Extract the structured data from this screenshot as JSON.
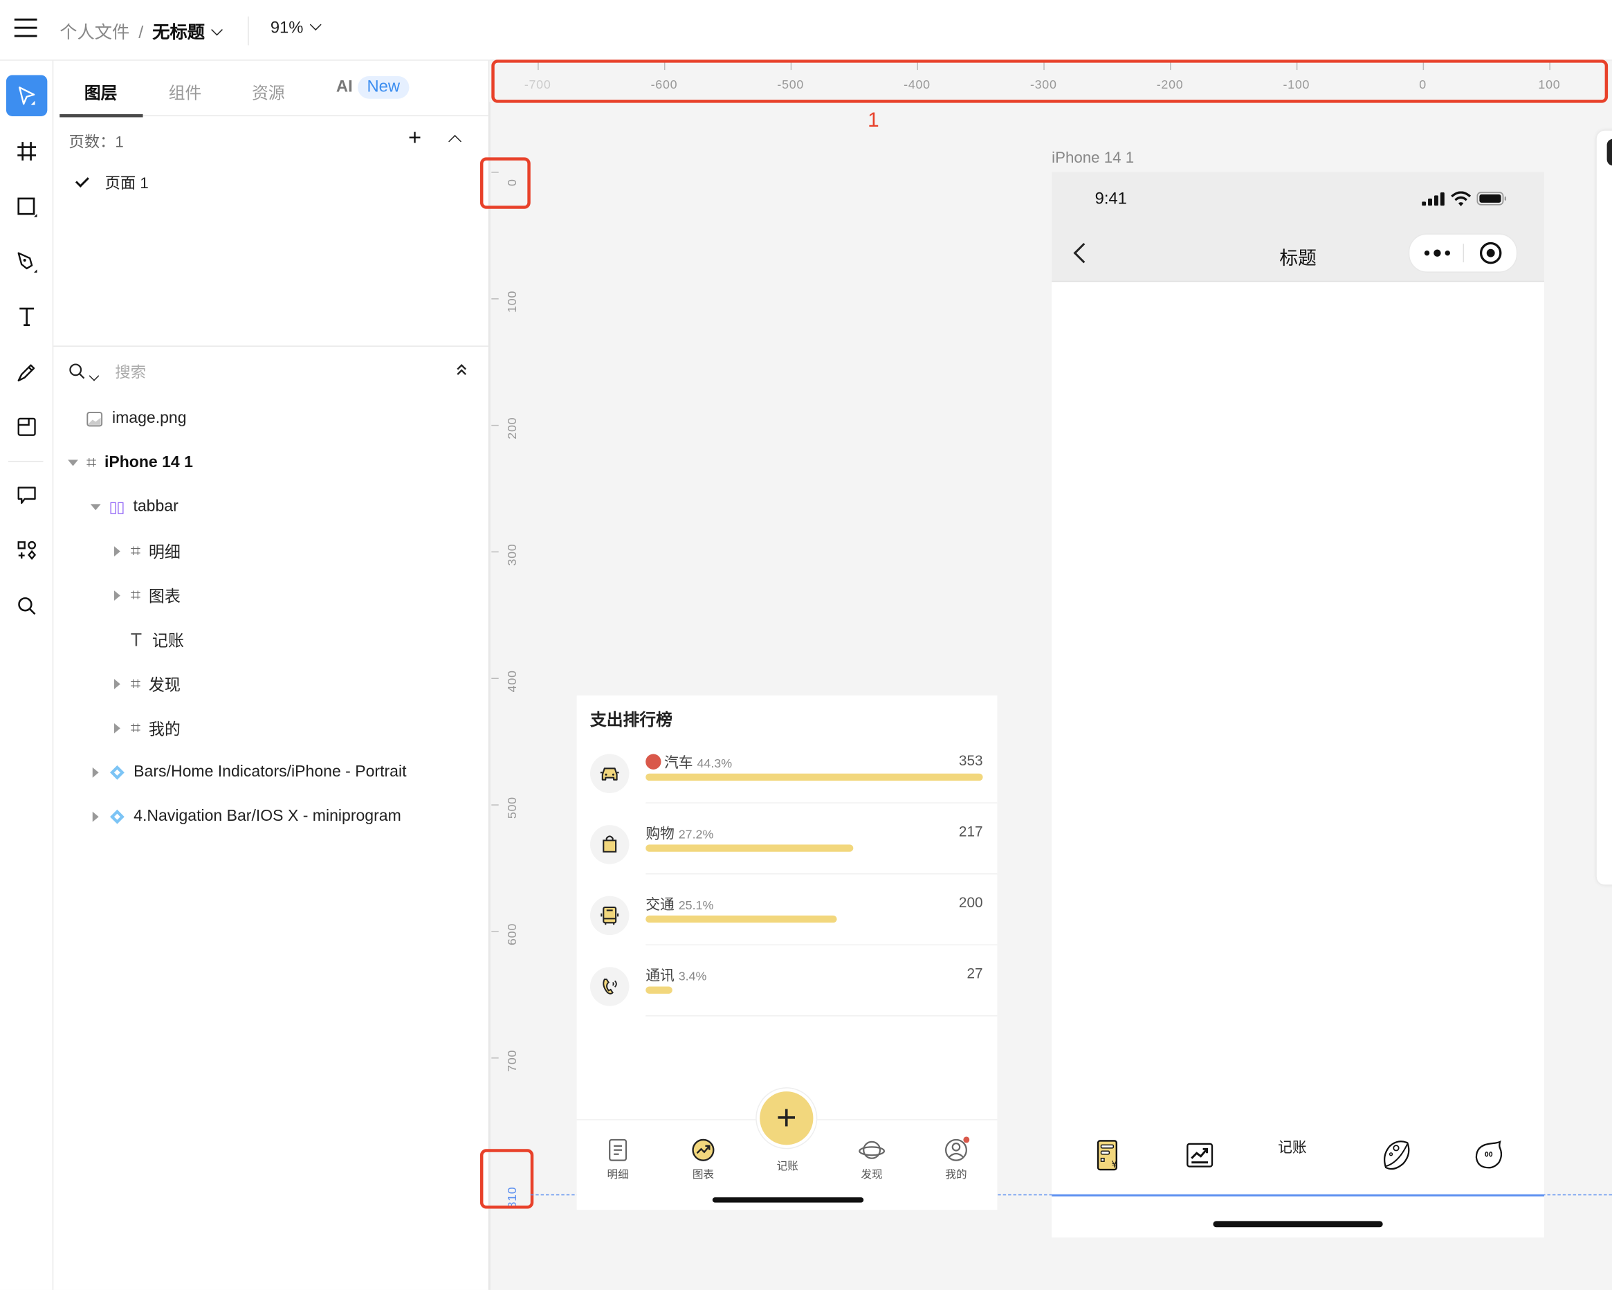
{
  "header": {
    "breadcrumb_parent": "个人文件",
    "breadcrumb_sep": "/",
    "file_title": "无标题",
    "zoom_level": "91%"
  },
  "toolbar": {
    "tools": [
      "move-tool",
      "frame-tool",
      "shape-tool",
      "pen-tool",
      "text-tool",
      "pencil-tool",
      "section-tool",
      "comment-tool",
      "plugins-tool",
      "search-tool"
    ],
    "active_tool": "move-tool",
    "accent_color": "#3d8ef0"
  },
  "panel": {
    "tabs": [
      {
        "label": "图层",
        "active": true
      },
      {
        "label": "组件",
        "active": false
      },
      {
        "label": "资源",
        "active": false
      },
      {
        "label": "AI",
        "active": false
      }
    ],
    "ai_badge": "New",
    "pages_label": "页数：1",
    "pages": [
      {
        "label": "页面 1",
        "selected": true
      }
    ],
    "search_placeholder": "搜索",
    "layers": [
      {
        "name": "image.png",
        "type": "image",
        "depth": 0
      },
      {
        "name": "iPhone 14 1",
        "type": "frame",
        "depth": 0,
        "expanded": true
      },
      {
        "name": "tabbar",
        "type": "auto-layout",
        "depth": 1,
        "expanded": true
      },
      {
        "name": "明细",
        "type": "frame",
        "depth": 2
      },
      {
        "name": "图表",
        "type": "frame",
        "depth": 2
      },
      {
        "name": "记账",
        "type": "text",
        "depth": 2
      },
      {
        "name": "发现",
        "type": "frame",
        "depth": 2
      },
      {
        "name": "我的",
        "type": "frame",
        "depth": 2
      },
      {
        "name": "Bars/Home Indicators/iPhone - Portrait",
        "type": "component",
        "depth": 1
      },
      {
        "name": "4.Navigation Bar/IOS X - miniprogram",
        "type": "component",
        "depth": 1
      }
    ]
  },
  "rulers": {
    "horizontal": [
      "-700",
      "-600",
      "-500",
      "-400",
      "-300",
      "-200",
      "-100",
      "0",
      "100"
    ],
    "vertical": [
      "0",
      "100",
      "200",
      "300",
      "400",
      "500",
      "600",
      "700"
    ],
    "vertical_marker": "810",
    "annotation": "1",
    "marker_color": "#5b8ff0",
    "annotation_color": "#e8412a"
  },
  "mock": {
    "title": "支出排行榜",
    "rows": [
      {
        "icon": "car-icon",
        "name": "汽车",
        "pct": "44.3%",
        "value": "353",
        "fraction": 1.0,
        "trend": true
      },
      {
        "icon": "shopping-bag-icon",
        "name": "购物",
        "pct": "27.2%",
        "value": "217",
        "fraction": 0.615
      },
      {
        "icon": "bus-icon",
        "name": "交通",
        "pct": "25.1%",
        "value": "200",
        "fraction": 0.567
      },
      {
        "icon": "phone-call-icon",
        "name": "通讯",
        "pct": "3.4%",
        "value": "27",
        "fraction": 0.077
      }
    ],
    "bar_color": "#f2d77d",
    "tabbar": [
      "明细",
      "图表",
      "记账",
      "发现",
      "我的"
    ]
  },
  "iphone": {
    "frame_label": "iPhone 14 1",
    "time": "9:41",
    "nav_title": "标题",
    "tabbar_text": "记账"
  }
}
